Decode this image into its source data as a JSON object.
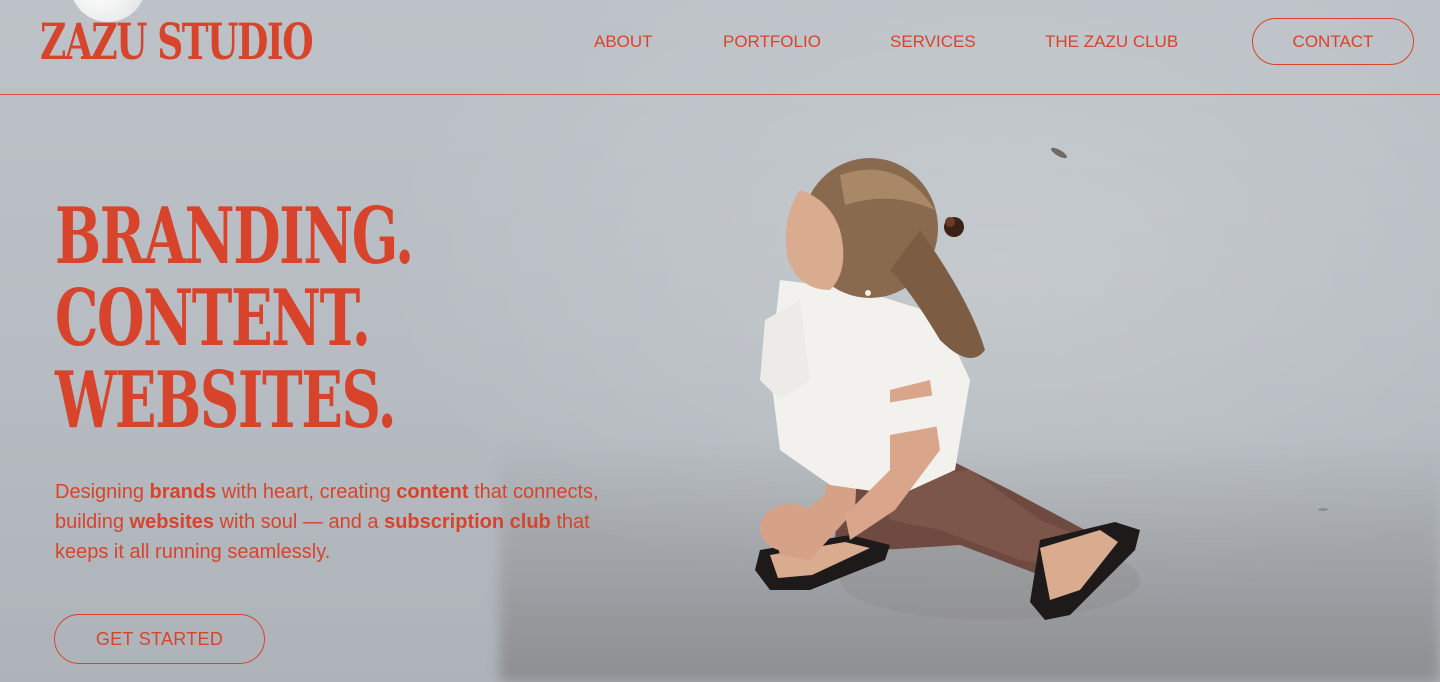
{
  "header": {
    "logo": "ZAZU STUDIO",
    "nav": [
      {
        "label": "ABOUT"
      },
      {
        "label": "PORTFOLIO"
      },
      {
        "label": "SERVICES"
      },
      {
        "label": "THE ZAZU CLUB"
      }
    ],
    "contact_label": "CONTACT"
  },
  "hero": {
    "headline": [
      "BRANDING.",
      "CONTENT.",
      "WEBSITES."
    ],
    "subtext": [
      {
        "text": "Designing ",
        "bold": false
      },
      {
        "text": "brands",
        "bold": true
      },
      {
        "text": " with heart, creating ",
        "bold": false
      },
      {
        "text": "content",
        "bold": true
      },
      {
        "text": " that connects, building ",
        "bold": false
      },
      {
        "text": "websites",
        "bold": true
      },
      {
        "text": " with soul — and a ",
        "bold": false
      },
      {
        "text": "subscription club",
        "bold": true
      },
      {
        "text": " that keeps it all running seamlessly.",
        "bold": false
      }
    ],
    "cta_label": "GET STARTED"
  },
  "colors": {
    "accent": "#d8442b",
    "background": "#b9bfc4"
  },
  "icons": {
    "hero_image": "woman-walking-photo"
  }
}
